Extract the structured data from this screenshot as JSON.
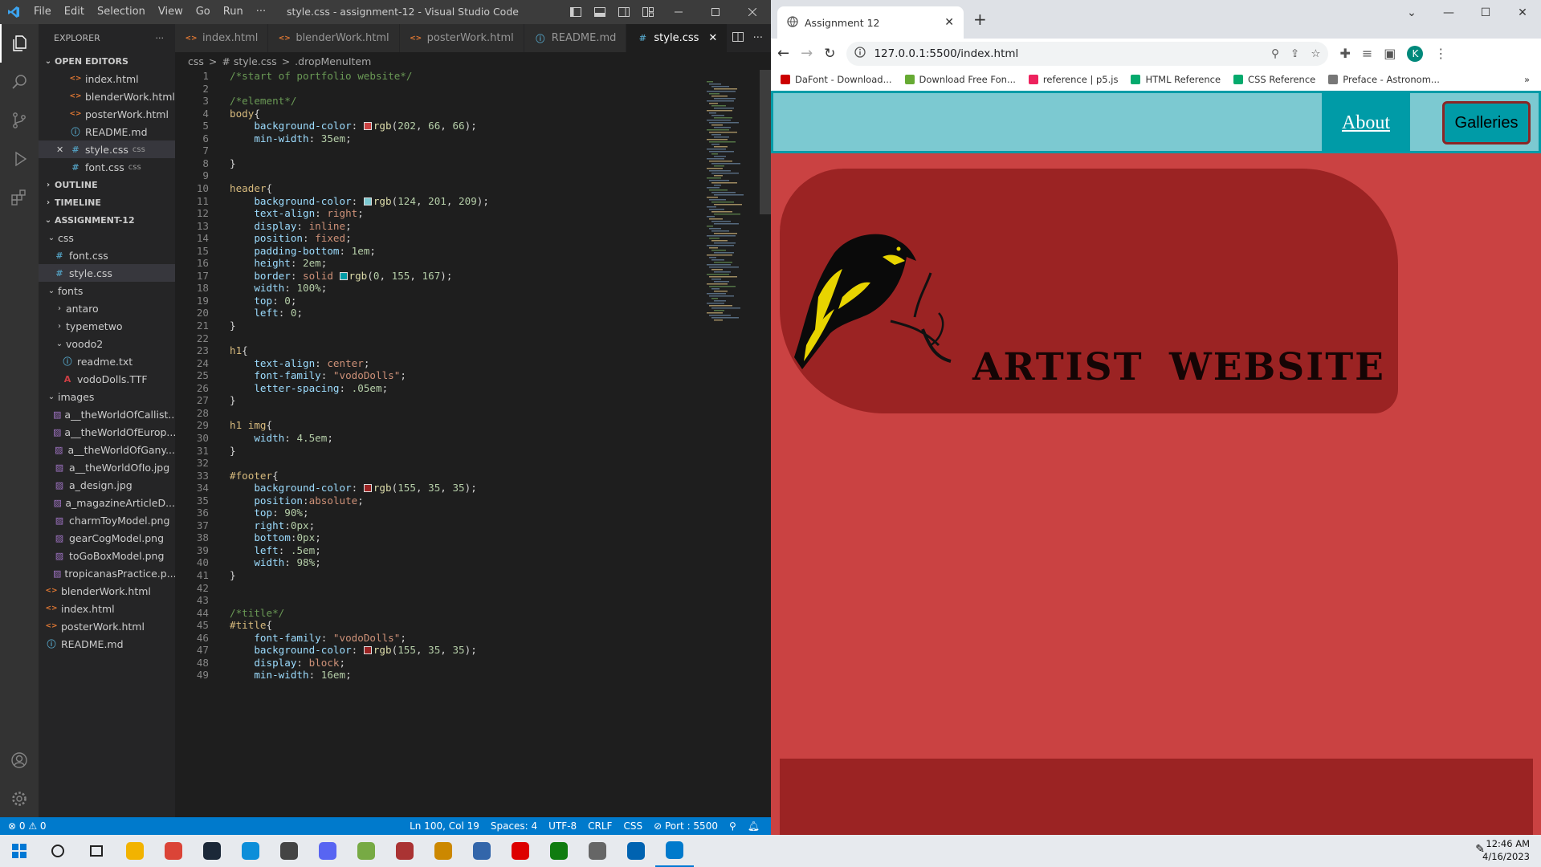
{
  "vscode": {
    "menu": [
      "File",
      "Edit",
      "Selection",
      "View",
      "Go",
      "Run",
      "···"
    ],
    "window_title": "style.css - assignment-12 - Visual Studio Code",
    "explorer_title": "EXPLORER",
    "open_editors_title": "OPEN EDITORS",
    "open_editors": [
      {
        "name": "index.html",
        "type": "html",
        "suffix": ""
      },
      {
        "name": "blenderWork.html",
        "type": "html",
        "suffix": ""
      },
      {
        "name": "posterWork.html",
        "type": "html",
        "suffix": ""
      },
      {
        "name": "README.md",
        "type": "md",
        "suffix": ""
      },
      {
        "name": "style.css",
        "type": "css",
        "suffix": "css"
      },
      {
        "name": "font.css",
        "type": "css",
        "suffix": "css"
      }
    ],
    "outline_title": "OUTLINE",
    "timeline_title": "TIMELINE",
    "project_title": "ASSIGNMENT-12",
    "tree": [
      {
        "name": "css",
        "type": "folder",
        "depth": 1,
        "open": true
      },
      {
        "name": "font.css",
        "type": "css",
        "depth": 2
      },
      {
        "name": "style.css",
        "type": "css",
        "depth": 2,
        "selected": true
      },
      {
        "name": "fonts",
        "type": "folder",
        "depth": 1,
        "open": true
      },
      {
        "name": "antaro",
        "type": "folder",
        "depth": 2,
        "open": false
      },
      {
        "name": "typemetwo",
        "type": "folder",
        "depth": 2,
        "open": false
      },
      {
        "name": "voodo2",
        "type": "folder",
        "depth": 2,
        "open": true
      },
      {
        "name": "readme.txt",
        "type": "txt",
        "depth": 3
      },
      {
        "name": "vodoDolls.TTF",
        "type": "ttf",
        "depth": 3
      },
      {
        "name": "images",
        "type": "folder",
        "depth": 1,
        "open": true
      },
      {
        "name": "a__theWorldOfCallist...",
        "type": "img",
        "depth": 2
      },
      {
        "name": "a__theWorldOfEurop...",
        "type": "img",
        "depth": 2
      },
      {
        "name": "a__theWorldOfGany...",
        "type": "img",
        "depth": 2
      },
      {
        "name": "a__theWorldOfIo.jpg",
        "type": "img",
        "depth": 2
      },
      {
        "name": "a_design.jpg",
        "type": "img",
        "depth": 2
      },
      {
        "name": "a_magazineArticleD...",
        "type": "img",
        "depth": 2
      },
      {
        "name": "charmToyModel.png",
        "type": "img",
        "depth": 2
      },
      {
        "name": "gearCogModel.png",
        "type": "img",
        "depth": 2
      },
      {
        "name": "toGoBoxModel.png",
        "type": "img",
        "depth": 2
      },
      {
        "name": "tropicanasPractice.p...",
        "type": "img",
        "depth": 2
      },
      {
        "name": "blenderWork.html",
        "type": "html",
        "depth": 1
      },
      {
        "name": "index.html",
        "type": "html",
        "depth": 1
      },
      {
        "name": "posterWork.html",
        "type": "html",
        "depth": 1
      },
      {
        "name": "README.md",
        "type": "md",
        "depth": 1
      }
    ],
    "tabs": [
      {
        "name": "index.html",
        "type": "html"
      },
      {
        "name": "blenderWork.html",
        "type": "html"
      },
      {
        "name": "posterWork.html",
        "type": "html"
      },
      {
        "name": "README.md",
        "type": "md"
      },
      {
        "name": "style.css",
        "type": "css",
        "active": true
      }
    ],
    "breadcrumb": [
      "css",
      ">",
      "# style.css",
      ">",
      ".dropMenuItem"
    ],
    "code": [
      [
        [
          "c",
          "/*start of portfolio website*/"
        ]
      ],
      [],
      [
        [
          "c",
          "/*element*/"
        ]
      ],
      [
        [
          "s",
          "body"
        ],
        [
          "p",
          "{"
        ]
      ],
      [
        [
          "p",
          "    "
        ],
        [
          "k",
          "background-color"
        ],
        [
          "p",
          ": "
        ],
        [
          "sw",
          "#ca4242"
        ],
        [
          "f",
          "rgb"
        ],
        [
          "p",
          "("
        ],
        [
          "n",
          "202"
        ],
        [
          "p",
          ", "
        ],
        [
          "n",
          "66"
        ],
        [
          "p",
          ", "
        ],
        [
          "n",
          "66"
        ],
        [
          "p",
          ");"
        ]
      ],
      [
        [
          "p",
          "    "
        ],
        [
          "k",
          "min-width"
        ],
        [
          "p",
          ": "
        ],
        [
          "n",
          "35em"
        ],
        [
          "p",
          ";"
        ]
      ],
      [],
      [
        [
          "p",
          "}"
        ]
      ],
      [],
      [
        [
          "s",
          "header"
        ],
        [
          "p",
          "{"
        ]
      ],
      [
        [
          "p",
          "    "
        ],
        [
          "k",
          "background-color"
        ],
        [
          "p",
          ": "
        ],
        [
          "sw",
          "#7cc9d1"
        ],
        [
          "f",
          "rgb"
        ],
        [
          "p",
          "("
        ],
        [
          "n",
          "124"
        ],
        [
          "p",
          ", "
        ],
        [
          "n",
          "201"
        ],
        [
          "p",
          ", "
        ],
        [
          "n",
          "209"
        ],
        [
          "p",
          ");"
        ]
      ],
      [
        [
          "p",
          "    "
        ],
        [
          "k",
          "text-align"
        ],
        [
          "p",
          ": "
        ],
        [
          "v",
          "right"
        ],
        [
          "p",
          ";"
        ]
      ],
      [
        [
          "p",
          "    "
        ],
        [
          "k",
          "display"
        ],
        [
          "p",
          ": "
        ],
        [
          "v",
          "inline"
        ],
        [
          "p",
          ";"
        ]
      ],
      [
        [
          "p",
          "    "
        ],
        [
          "k",
          "position"
        ],
        [
          "p",
          ": "
        ],
        [
          "v",
          "fixed"
        ],
        [
          "p",
          ";"
        ]
      ],
      [
        [
          "p",
          "    "
        ],
        [
          "k",
          "padding-bottom"
        ],
        [
          "p",
          ": "
        ],
        [
          "n",
          "1em"
        ],
        [
          "p",
          ";"
        ]
      ],
      [
        [
          "p",
          "    "
        ],
        [
          "k",
          "height"
        ],
        [
          "p",
          ": "
        ],
        [
          "n",
          "2em"
        ],
        [
          "p",
          ";"
        ]
      ],
      [
        [
          "p",
          "    "
        ],
        [
          "k",
          "border"
        ],
        [
          "p",
          ": "
        ],
        [
          "v",
          "solid "
        ],
        [
          "sw",
          "#009ba7"
        ],
        [
          "f",
          "rgb"
        ],
        [
          "p",
          "("
        ],
        [
          "n",
          "0"
        ],
        [
          "p",
          ", "
        ],
        [
          "n",
          "155"
        ],
        [
          "p",
          ", "
        ],
        [
          "n",
          "167"
        ],
        [
          "p",
          ");"
        ]
      ],
      [
        [
          "p",
          "    "
        ],
        [
          "k",
          "width"
        ],
        [
          "p",
          ": "
        ],
        [
          "n",
          "100%"
        ],
        [
          "p",
          ";"
        ]
      ],
      [
        [
          "p",
          "    "
        ],
        [
          "k",
          "top"
        ],
        [
          "p",
          ": "
        ],
        [
          "n",
          "0"
        ],
        [
          "p",
          ";"
        ]
      ],
      [
        [
          "p",
          "    "
        ],
        [
          "k",
          "left"
        ],
        [
          "p",
          ": "
        ],
        [
          "n",
          "0"
        ],
        [
          "p",
          ";"
        ]
      ],
      [
        [
          "p",
          "}"
        ]
      ],
      [],
      [
        [
          "s",
          "h1"
        ],
        [
          "p",
          "{"
        ]
      ],
      [
        [
          "p",
          "    "
        ],
        [
          "k",
          "text-align"
        ],
        [
          "p",
          ": "
        ],
        [
          "v",
          "center"
        ],
        [
          "p",
          ";"
        ]
      ],
      [
        [
          "p",
          "    "
        ],
        [
          "k",
          "font-family"
        ],
        [
          "p",
          ": "
        ],
        [
          "v",
          "\"vodoDolls\""
        ],
        [
          "p",
          ";"
        ]
      ],
      [
        [
          "p",
          "    "
        ],
        [
          "k",
          "letter-spacing"
        ],
        [
          "p",
          ": "
        ],
        [
          "n",
          ".05em"
        ],
        [
          "p",
          ";"
        ]
      ],
      [
        [
          "p",
          "}"
        ]
      ],
      [],
      [
        [
          "s",
          "h1 img"
        ],
        [
          "p",
          "{"
        ]
      ],
      [
        [
          "p",
          "    "
        ],
        [
          "k",
          "width"
        ],
        [
          "p",
          ": "
        ],
        [
          "n",
          "4.5em"
        ],
        [
          "p",
          ";"
        ]
      ],
      [
        [
          "p",
          "}"
        ]
      ],
      [],
      [
        [
          "s",
          "#footer"
        ],
        [
          "p",
          "{"
        ]
      ],
      [
        [
          "p",
          "    "
        ],
        [
          "k",
          "background-color"
        ],
        [
          "p",
          ": "
        ],
        [
          "sw",
          "#9b2323"
        ],
        [
          "f",
          "rgb"
        ],
        [
          "p",
          "("
        ],
        [
          "n",
          "155"
        ],
        [
          "p",
          ", "
        ],
        [
          "n",
          "35"
        ],
        [
          "p",
          ", "
        ],
        [
          "n",
          "35"
        ],
        [
          "p",
          ");"
        ]
      ],
      [
        [
          "p",
          "    "
        ],
        [
          "k",
          "position"
        ],
        [
          "p",
          ":"
        ],
        [
          "v",
          "absolute"
        ],
        [
          "p",
          ";"
        ]
      ],
      [
        [
          "p",
          "    "
        ],
        [
          "k",
          "top"
        ],
        [
          "p",
          ": "
        ],
        [
          "n",
          "90%"
        ],
        [
          "p",
          ";"
        ]
      ],
      [
        [
          "p",
          "    "
        ],
        [
          "k",
          "right"
        ],
        [
          "p",
          ":"
        ],
        [
          "n",
          "0px"
        ],
        [
          "p",
          ";"
        ]
      ],
      [
        [
          "p",
          "    "
        ],
        [
          "k",
          "bottom"
        ],
        [
          "p",
          ":"
        ],
        [
          "n",
          "0px"
        ],
        [
          "p",
          ";"
        ]
      ],
      [
        [
          "p",
          "    "
        ],
        [
          "k",
          "left"
        ],
        [
          "p",
          ": "
        ],
        [
          "n",
          ".5em"
        ],
        [
          "p",
          ";"
        ]
      ],
      [
        [
          "p",
          "    "
        ],
        [
          "k",
          "width"
        ],
        [
          "p",
          ": "
        ],
        [
          "n",
          "98%"
        ],
        [
          "p",
          ";"
        ]
      ],
      [
        [
          "p",
          "}"
        ]
      ],
      [],
      [],
      [
        [
          "c",
          "/*title*/"
        ]
      ],
      [
        [
          "s",
          "#title"
        ],
        [
          "p",
          "{"
        ]
      ],
      [
        [
          "p",
          "    "
        ],
        [
          "k",
          "font-family"
        ],
        [
          "p",
          ": "
        ],
        [
          "v",
          "\"vodoDolls\""
        ],
        [
          "p",
          ";"
        ]
      ],
      [
        [
          "p",
          "    "
        ],
        [
          "k",
          "background-color"
        ],
        [
          "p",
          ": "
        ],
        [
          "sw",
          "#9b2323"
        ],
        [
          "f",
          "rgb"
        ],
        [
          "p",
          "("
        ],
        [
          "n",
          "155"
        ],
        [
          "p",
          ", "
        ],
        [
          "n",
          "35"
        ],
        [
          "p",
          ", "
        ],
        [
          "n",
          "35"
        ],
        [
          "p",
          ");"
        ]
      ],
      [
        [
          "p",
          "    "
        ],
        [
          "k",
          "display"
        ],
        [
          "p",
          ": "
        ],
        [
          "v",
          "block"
        ],
        [
          "p",
          ";"
        ]
      ],
      [
        [
          "p",
          "    "
        ],
        [
          "k",
          "min-width"
        ],
        [
          "p",
          ": "
        ],
        [
          "n",
          "16em"
        ],
        [
          "p",
          ";"
        ]
      ]
    ],
    "status": {
      "problems": "⊗ 0 ⚠ 0",
      "position": "Ln 100, Col 19",
      "spaces": "Spaces: 4",
      "encoding": "UTF-8",
      "eol": "CRLF",
      "language": "CSS",
      "port": "⊘ Port : 5500"
    }
  },
  "chrome": {
    "tab_title": "Assignment 12",
    "url": "127.0.0.1:5500/index.html",
    "profile_initial": "K",
    "bookmarks": [
      {
        "label": "DaFont - Download...",
        "color": "#c00"
      },
      {
        "label": "Download Free Fon...",
        "color": "#6a3"
      },
      {
        "label": "reference | p5.js",
        "color": "#ed225d"
      },
      {
        "label": "HTML Reference",
        "color": "#04aa6d"
      },
      {
        "label": "CSS Reference",
        "color": "#04aa6d"
      },
      {
        "label": "Preface - Astronom...",
        "color": "#777"
      }
    ]
  },
  "website": {
    "nav_about": "About",
    "nav_galleries": "Galleries",
    "title": "ARTIST  WEBSITE"
  },
  "taskbar": {
    "time": "12:46 AM",
    "date": "4/16/2023",
    "apps": [
      "start",
      "search",
      "task-view",
      "file-explorer",
      "chrome",
      "steam",
      "edge",
      "twitch",
      "discord",
      "game1",
      "game2",
      "game3",
      "game4",
      "acrobat",
      "xbox",
      "app-ring",
      "mail",
      "vscode"
    ]
  }
}
